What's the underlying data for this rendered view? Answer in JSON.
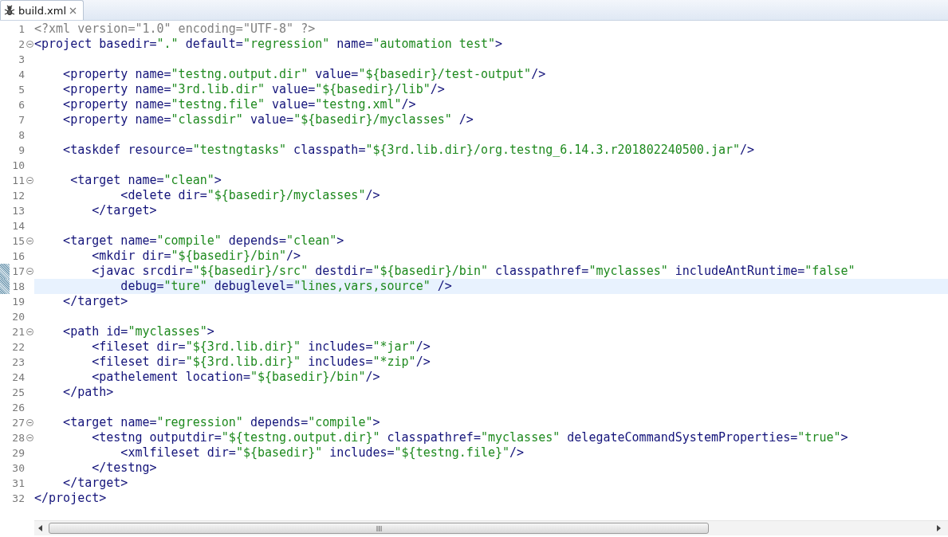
{
  "tab": {
    "title": "build.xml",
    "selected": true
  },
  "lines": [
    {
      "number": "1",
      "tokens": [
        {
          "kind": "decl",
          "text": "<?xml version=\"1.0\" encoding=\"UTF-8\" ?>"
        }
      ]
    },
    {
      "number": "2",
      "foldable": true,
      "tokens": [
        {
          "kind": "markup",
          "text": "<project basedir="
        },
        {
          "kind": "value",
          "text": "\".\""
        },
        {
          "kind": "markup",
          "text": " default="
        },
        {
          "kind": "value",
          "text": "\"regression\""
        },
        {
          "kind": "markup",
          "text": " name="
        },
        {
          "kind": "value",
          "text": "\"automation test\""
        },
        {
          "kind": "markup",
          "text": ">"
        }
      ]
    },
    {
      "number": "3"
    },
    {
      "number": "4",
      "tokens": [
        {
          "kind": "markup",
          "text": "    <property name="
        },
        {
          "kind": "value",
          "text": "\"testng.output.dir\""
        },
        {
          "kind": "markup",
          "text": " value="
        },
        {
          "kind": "value",
          "text": "\"${basedir}/test-output\""
        },
        {
          "kind": "markup",
          "text": "/>"
        }
      ]
    },
    {
      "number": "5",
      "tokens": [
        {
          "kind": "markup",
          "text": "    <property name="
        },
        {
          "kind": "value",
          "text": "\"3rd.lib.dir\""
        },
        {
          "kind": "markup",
          "text": " value="
        },
        {
          "kind": "value",
          "text": "\"${basedir}/lib\""
        },
        {
          "kind": "markup",
          "text": "/>"
        }
      ]
    },
    {
      "number": "6",
      "tokens": [
        {
          "kind": "markup",
          "text": "    <property name="
        },
        {
          "kind": "value",
          "text": "\"testng.file\""
        },
        {
          "kind": "markup",
          "text": " value="
        },
        {
          "kind": "value",
          "text": "\"testng.xml\""
        },
        {
          "kind": "markup",
          "text": "/>"
        }
      ]
    },
    {
      "number": "7",
      "tokens": [
        {
          "kind": "markup",
          "text": "    <property name="
        },
        {
          "kind": "value",
          "text": "\"classdir\""
        },
        {
          "kind": "markup",
          "text": " value="
        },
        {
          "kind": "value",
          "text": "\"${basedir}/myclasses\""
        },
        {
          "kind": "markup",
          "text": " />"
        }
      ]
    },
    {
      "number": "8"
    },
    {
      "number": "9",
      "tokens": [
        {
          "kind": "markup",
          "text": "    <taskdef resource="
        },
        {
          "kind": "value",
          "text": "\"testngtasks\""
        },
        {
          "kind": "markup",
          "text": " classpath="
        },
        {
          "kind": "value",
          "text": "\"${3rd.lib.dir}/org.testng_6.14.3.r201802240500.jar\""
        },
        {
          "kind": "markup",
          "text": "/>"
        }
      ]
    },
    {
      "number": "10"
    },
    {
      "number": "11",
      "foldable": true,
      "tokens": [
        {
          "kind": "markup",
          "text": "     <target name="
        },
        {
          "kind": "value",
          "text": "\"clean\""
        },
        {
          "kind": "markup",
          "text": ">"
        }
      ]
    },
    {
      "number": "12",
      "tokens": [
        {
          "kind": "markup",
          "text": "            <delete dir="
        },
        {
          "kind": "value",
          "text": "\"${basedir}/myclasses\""
        },
        {
          "kind": "markup",
          "text": "/>"
        }
      ]
    },
    {
      "number": "13",
      "tokens": [
        {
          "kind": "markup",
          "text": "        </target>"
        }
      ]
    },
    {
      "number": "14"
    },
    {
      "number": "15",
      "foldable": true,
      "tokens": [
        {
          "kind": "markup",
          "text": "    <target name="
        },
        {
          "kind": "value",
          "text": "\"compile\""
        },
        {
          "kind": "markup",
          "text": " depends="
        },
        {
          "kind": "value",
          "text": "\"clean\""
        },
        {
          "kind": "markup",
          "text": ">"
        }
      ]
    },
    {
      "number": "16",
      "tokens": [
        {
          "kind": "markup",
          "text": "        <mkdir dir="
        },
        {
          "kind": "value",
          "text": "\"${basedir}/bin\""
        },
        {
          "kind": "markup",
          "text": "/>"
        }
      ]
    },
    {
      "number": "17",
      "foldable": true,
      "changed": true,
      "tokens": [
        {
          "kind": "markup",
          "text": "        <javac srcdir="
        },
        {
          "kind": "value",
          "text": "\"${basedir}/src\""
        },
        {
          "kind": "markup",
          "text": " destdir="
        },
        {
          "kind": "value",
          "text": "\"${basedir}/bin\""
        },
        {
          "kind": "markup",
          "text": " classpathref="
        },
        {
          "kind": "value",
          "text": "\"myclasses\""
        },
        {
          "kind": "markup",
          "text": " includeAntRuntime="
        },
        {
          "kind": "value",
          "text": "\"false\""
        }
      ]
    },
    {
      "number": "18",
      "changed": true,
      "current": true,
      "tokens": [
        {
          "kind": "markup",
          "text": "            debug="
        },
        {
          "kind": "value",
          "text": "\"ture\""
        },
        {
          "kind": "markup",
          "text": " debuglevel="
        },
        {
          "kind": "value",
          "text": "\"lines,vars,source\""
        },
        {
          "kind": "markup",
          "text": " />"
        }
      ]
    },
    {
      "number": "19",
      "tokens": [
        {
          "kind": "markup",
          "text": "    </target>"
        }
      ]
    },
    {
      "number": "20"
    },
    {
      "number": "21",
      "foldable": true,
      "tokens": [
        {
          "kind": "markup",
          "text": "    <path id="
        },
        {
          "kind": "value",
          "text": "\"myclasses\""
        },
        {
          "kind": "markup",
          "text": ">"
        }
      ]
    },
    {
      "number": "22",
      "tokens": [
        {
          "kind": "markup",
          "text": "        <fileset dir="
        },
        {
          "kind": "value",
          "text": "\"${3rd.lib.dir}\""
        },
        {
          "kind": "markup",
          "text": " includes="
        },
        {
          "kind": "value",
          "text": "\"*jar\""
        },
        {
          "kind": "markup",
          "text": "/>"
        }
      ]
    },
    {
      "number": "23",
      "tokens": [
        {
          "kind": "markup",
          "text": "        <fileset dir="
        },
        {
          "kind": "value",
          "text": "\"${3rd.lib.dir}\""
        },
        {
          "kind": "markup",
          "text": " includes="
        },
        {
          "kind": "value",
          "text": "\"*zip\""
        },
        {
          "kind": "markup",
          "text": "/>"
        }
      ]
    },
    {
      "number": "24",
      "tokens": [
        {
          "kind": "markup",
          "text": "        <pathelement location="
        },
        {
          "kind": "value",
          "text": "\"${basedir}/bin\""
        },
        {
          "kind": "markup",
          "text": "/>"
        }
      ]
    },
    {
      "number": "25",
      "tokens": [
        {
          "kind": "markup",
          "text": "    </path>"
        }
      ]
    },
    {
      "number": "26"
    },
    {
      "number": "27",
      "foldable": true,
      "tokens": [
        {
          "kind": "markup",
          "text": "    <target name="
        },
        {
          "kind": "value",
          "text": "\"regression\""
        },
        {
          "kind": "markup",
          "text": " depends="
        },
        {
          "kind": "value",
          "text": "\"compile\""
        },
        {
          "kind": "markup",
          "text": ">"
        }
      ]
    },
    {
      "number": "28",
      "foldable": true,
      "tokens": [
        {
          "kind": "markup",
          "text": "        <testng outputdir="
        },
        {
          "kind": "value",
          "text": "\"${testng.output.dir}\""
        },
        {
          "kind": "markup",
          "text": " classpathref="
        },
        {
          "kind": "value",
          "text": "\"myclasses\""
        },
        {
          "kind": "markup",
          "text": " delegateCommandSystemProperties="
        },
        {
          "kind": "value",
          "text": "\"true\""
        },
        {
          "kind": "markup",
          "text": ">"
        }
      ]
    },
    {
      "number": "29",
      "tokens": [
        {
          "kind": "markup",
          "text": "            <xmlfileset dir="
        },
        {
          "kind": "value",
          "text": "\"${basedir}\""
        },
        {
          "kind": "markup",
          "text": " includes="
        },
        {
          "kind": "value",
          "text": "\"${testng.file}\""
        },
        {
          "kind": "markup",
          "text": "/>"
        }
      ]
    },
    {
      "number": "30",
      "tokens": [
        {
          "kind": "markup",
          "text": "        </testng>"
        }
      ]
    },
    {
      "number": "31",
      "tokens": [
        {
          "kind": "markup",
          "text": "    </target>"
        }
      ]
    },
    {
      "number": "32",
      "tokens": [
        {
          "kind": "markup",
          "text": "</project>"
        }
      ]
    }
  ]
}
